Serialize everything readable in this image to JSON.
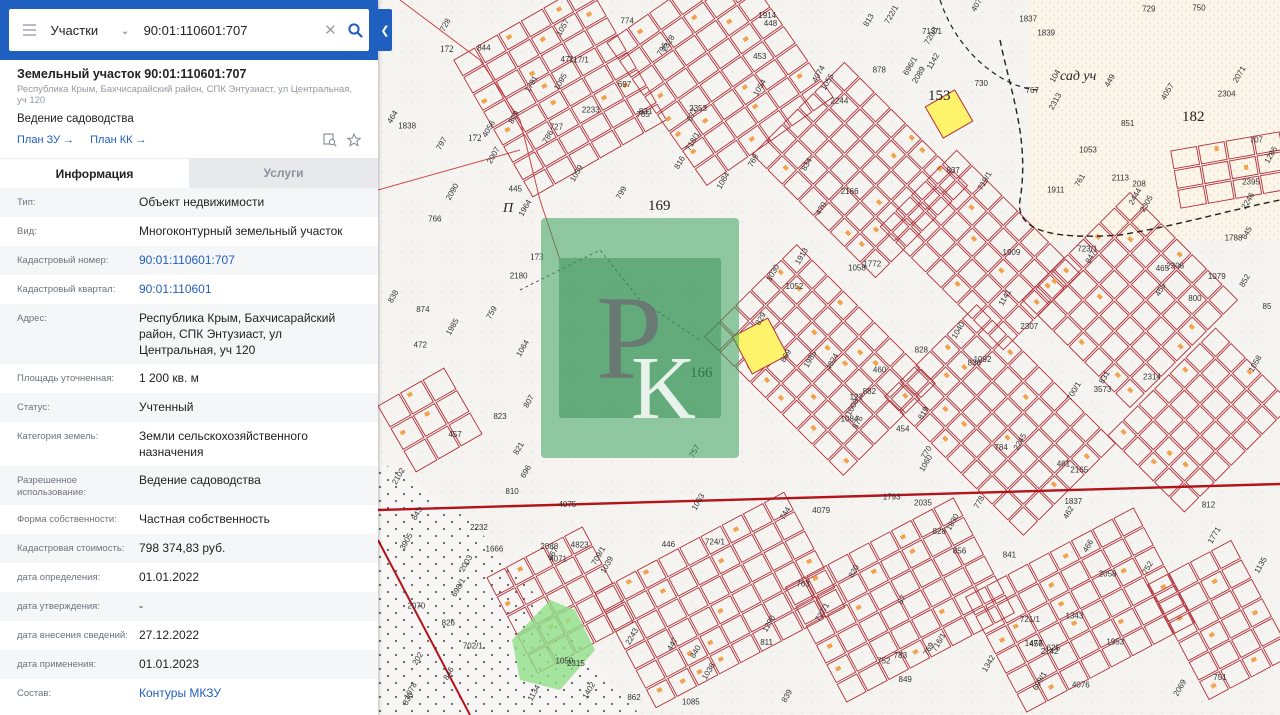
{
  "search": {
    "category": "Участки",
    "query": "90:01:110601:707"
  },
  "object": {
    "title": "Земельный участок 90:01:110601:707",
    "address": "Республика Крым, Бахчисарайский район, СПК Энтузиаст, ул Центральная, уч 120",
    "usage": "Ведение садоводства",
    "plan_zu": "План ЗУ →",
    "plan_kk": "План КК →"
  },
  "tabs": [
    {
      "label": "Информация",
      "active": true
    },
    {
      "label": "Услуги",
      "active": false
    }
  ],
  "rows": [
    {
      "label": "Тип:",
      "value": "Объект недвижимости"
    },
    {
      "label": "Вид:",
      "value": "Многоконтурный земельный участок"
    },
    {
      "label": "Кадастровый номер:",
      "value": "90:01:110601:707",
      "link": true
    },
    {
      "label": "Кадастровый квартал:",
      "value": "90:01:110601",
      "link": true
    },
    {
      "label": "Адрес:",
      "value": "Республика Крым, Бахчисарайский район, СПК Энтузиаст, ул Центральная, уч 120"
    },
    {
      "label": "Площадь уточненная:",
      "value": "1 200 кв. м"
    },
    {
      "label": "Статус:",
      "value": "Учтенный"
    },
    {
      "label": "Категория земель:",
      "value": "Земли сельскохозяйственного назначения"
    },
    {
      "label": "Разрешенное использование:",
      "value": "Ведение садоводства"
    },
    {
      "label": "Форма собственности:",
      "value": "Частная собственность"
    },
    {
      "label": "Кадастровая стоимость:",
      "value": "798 374,83 руб."
    },
    {
      "label": "дата определения:",
      "value": "01.01.2022"
    },
    {
      "label": "дата утверждения:",
      "value": "-"
    },
    {
      "label": "дата внесения сведений:",
      "value": "27.12.2022"
    },
    {
      "label": "дата применения:",
      "value": "01.01.2023"
    },
    {
      "label": "Состав:",
      "value": "Контуры МКЗУ",
      "link": true
    }
  ],
  "map": {
    "labels": [
      "169",
      "166",
      "153",
      "182",
      "172",
      "172",
      "173",
      "П",
      "сад уч",
      "1477",
      "208",
      "85",
      "87",
      "202",
      "104",
      "2088",
      "1909",
      "1911",
      "2142",
      "2232",
      "2233",
      "882",
      "1913",
      "1914",
      "1953",
      "1985",
      "2089",
      "2113",
      "1964",
      "2102",
      "2058",
      "2071",
      "2069",
      "2070",
      "2313",
      "2166",
      "2245",
      "2165",
      "1666",
      "2180",
      "2243",
      "1771",
      "1772",
      "2244",
      "1838",
      "2035",
      "2090",
      "2444",
      "2353",
      "2246",
      "1791",
      "2328",
      "2314",
      "2315",
      "1837",
      "2395",
      "1402",
      "1788",
      "1793",
      "1985",
      "4056",
      "4057",
      "4823",
      "4824",
      "4071",
      "4072",
      "4075",
      "4074",
      "4076",
      "4079",
      "3905",
      "3573",
      "856",
      "2003",
      "1830",
      "1837",
      "1839",
      "2007",
      "862",
      "828",
      "783",
      "752",
      "707",
      "697",
      "449",
      "457",
      "448",
      "446",
      "445",
      "447",
      "785",
      "1030",
      "1057",
      "1058",
      "1059",
      "1060",
      "1063",
      "826",
      "807",
      "797",
      "786",
      "751",
      "625",
      "472",
      "471",
      "730",
      "729",
      "727",
      "728",
      "750",
      "1064",
      "1050",
      "744",
      "470",
      "778",
      "774",
      "784",
      "1036",
      "1141",
      "759",
      "874",
      "752",
      "1078",
      "1079",
      "838",
      "836",
      "796",
      "799",
      "800",
      "769",
      "1095",
      "1092",
      "1039",
      "1052",
      "1135",
      "1134",
      "1142",
      "696",
      "122",
      "809",
      "811",
      "1053",
      "1040",
      "1054",
      "1008",
      "1084",
      "1085",
      "1084",
      "1055",
      "1058",
      "831",
      "823",
      "839",
      "841",
      "876",
      "878",
      "877",
      "816",
      "812",
      "813",
      "819",
      "820",
      "767",
      "769",
      "770",
      "810",
      "828",
      "829",
      "830",
      "831",
      "821",
      "869",
      "834",
      "837",
      "840",
      "843",
      "844",
      "845",
      "846",
      "847",
      "849",
      "851",
      "852",
      "453",
      "454",
      "455",
      "456",
      "460",
      "461",
      "462",
      "464",
      "465",
      "466",
      "467",
      "763",
      "766",
      "757",
      "761",
      "700/1",
      "699/1",
      "702/1",
      "709/1",
      "713/1",
      "720/1",
      "719/1",
      "717/1",
      "716/1",
      "718/1",
      "723/1",
      "724/1",
      "727/1",
      "696/1",
      "698/1",
      "721/1",
      "722/1",
      "1286",
      "1290",
      "1342",
      "1343",
      "2307",
      "2304",
      "2305",
      "2306"
    ]
  }
}
